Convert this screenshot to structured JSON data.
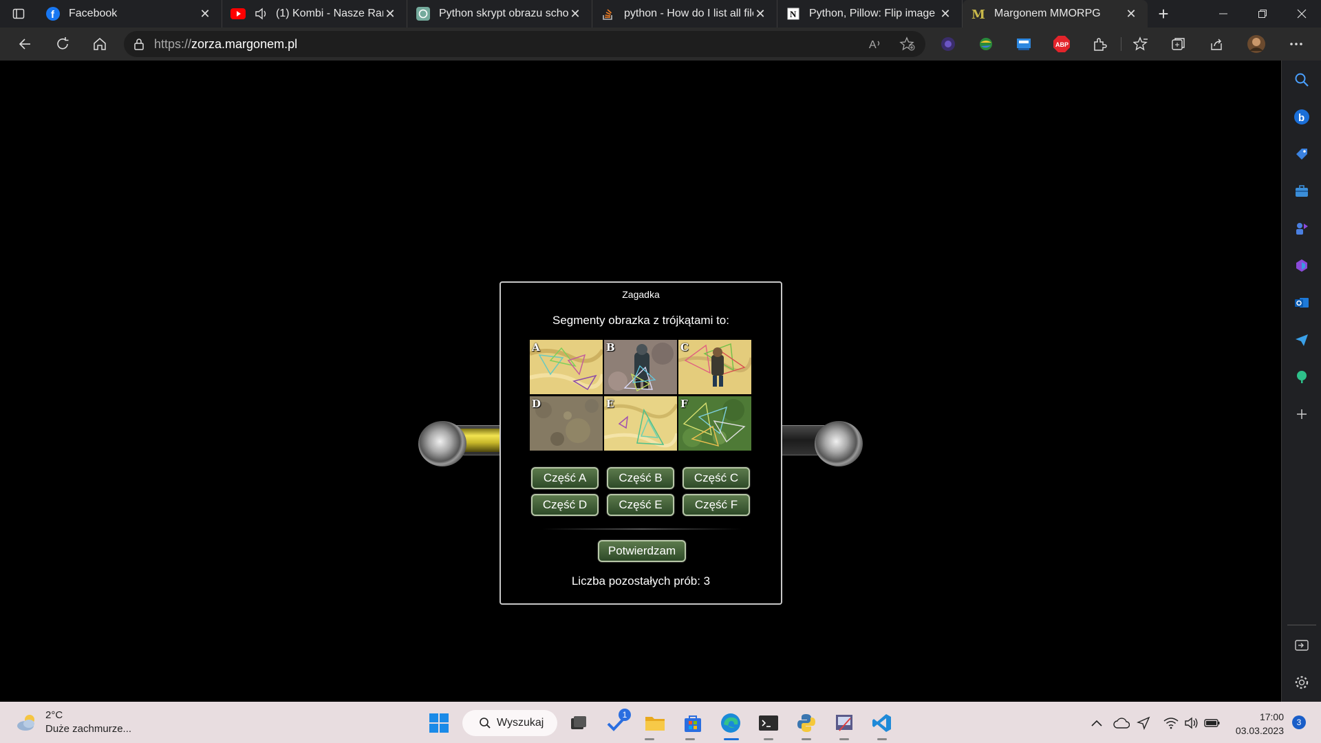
{
  "browser": {
    "tabs": [
      {
        "title": "Facebook",
        "icon": "facebook-icon"
      },
      {
        "title": "(1) Kombi - Nasze Rand",
        "icon": "youtube-icon"
      },
      {
        "title": "Python skrypt obrazu schow",
        "icon": "chatgpt-icon"
      },
      {
        "title": "python - How do I list all file",
        "icon": "stackoverflow-icon"
      },
      {
        "title": "Python, Pillow: Flip image | n",
        "icon": "notion-icon"
      },
      {
        "title": "Margonem MMORPG",
        "icon": "margonem-icon"
      }
    ],
    "url_scheme": "https://",
    "url_host": "zorza.margonem.pl",
    "extension_abp": "ABP"
  },
  "dialog": {
    "title": "Zagadka",
    "question": "Segmenty obrazka z trójkątami to:",
    "segments": [
      "A",
      "B",
      "C",
      "D",
      "E",
      "F"
    ],
    "buttons": [
      "Część A",
      "Część B",
      "Część C",
      "Część D",
      "Część E",
      "Część F"
    ],
    "confirm": "Potwierdzam",
    "tries": "Liczba pozostałych prób: 3"
  },
  "taskbar": {
    "weather_temp": "2°C",
    "weather_desc": "Duże zachmurze...",
    "search": "Wyszukaj",
    "badge_todo": "1",
    "time": "17:00",
    "date": "03.03.2023",
    "notif_count": "3"
  }
}
